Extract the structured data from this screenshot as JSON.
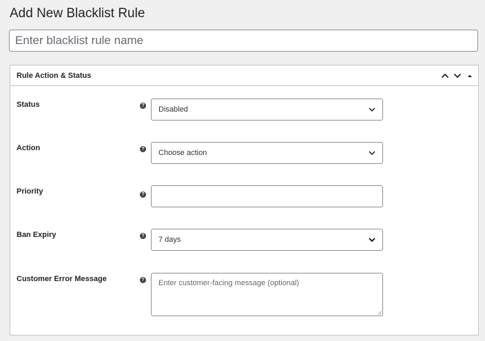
{
  "page": {
    "title": "Add New Blacklist Rule"
  },
  "rule_name": {
    "placeholder": "Enter blacklist rule name",
    "value": ""
  },
  "metabox": {
    "title": "Rule Action & Status",
    "controls": [
      "move-up-icon",
      "move-down-icon",
      "toggle-panel-icon"
    ]
  },
  "fields": {
    "status": {
      "label": "Status",
      "help": "?",
      "value": "Disabled",
      "icon": "chevron-down-icon"
    },
    "action": {
      "label": "Action",
      "help": "?",
      "value": "Choose action",
      "icon": "chevron-down-icon"
    },
    "priority": {
      "label": "Priority",
      "help": "?",
      "value": ""
    },
    "ban_expiry": {
      "label": "Ban Expiry",
      "help": "?",
      "value": "7 days",
      "icon": "chevron-down-icon"
    },
    "error_message": {
      "label": "Customer Error Message",
      "help": "?",
      "placeholder": "Enter customer-facing message (optional)"
    }
  }
}
